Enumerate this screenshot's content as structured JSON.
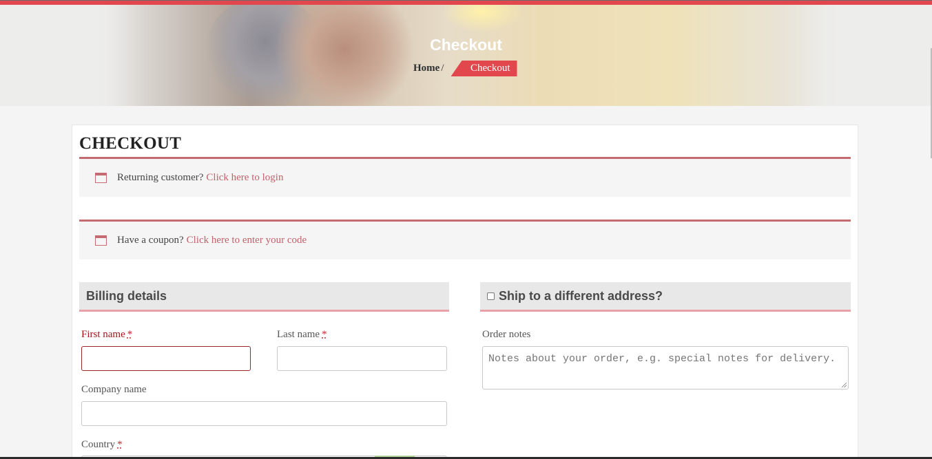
{
  "hero": {
    "title": "Checkout",
    "breadcrumb": {
      "home": "Home",
      "separator": "/",
      "current": "Checkout"
    }
  },
  "page": {
    "title": "CHECKOUT"
  },
  "notices": {
    "login": {
      "text": "Returning customer?",
      "link": "Click here to login"
    },
    "coupon": {
      "text": "Have a coupon?",
      "link": "Click here to enter your code"
    }
  },
  "billing": {
    "heading": "Billing details",
    "fields": {
      "first_name": {
        "label": "First name",
        "required": "*",
        "value": ""
      },
      "last_name": {
        "label": "Last name",
        "required": "*",
        "value": ""
      },
      "company": {
        "label": "Company name",
        "value": ""
      },
      "country": {
        "label": "Country",
        "required": "*"
      }
    }
  },
  "shipping": {
    "heading": "Ship to a different address?",
    "checked": false,
    "order_notes": {
      "label": "Order notes",
      "placeholder": "Notes about your order, e.g. special notes for delivery."
    }
  },
  "colors": {
    "accent": "#e2474e",
    "notice_border": "#c66a72",
    "link": "#c0626b",
    "error": "#a0131b"
  },
  "icons": {
    "notice": "calendar-icon"
  }
}
